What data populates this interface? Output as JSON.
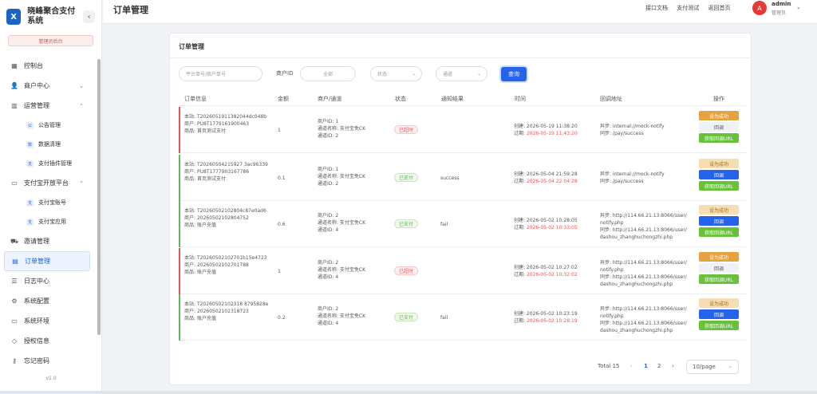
{
  "brand": {
    "logo": "X",
    "name": "晓峰聚合支付系统",
    "collapse": "‹",
    "role_tag": "管理员后台"
  },
  "nav": {
    "dashboard": "控制台",
    "merchant_center": "商户中心",
    "operation": "运营管理",
    "announcements": "公告管理",
    "data_cleanup": "数据清理",
    "plugin_mgmt": "支付插件管理",
    "alipay_platform": "支付宝开放平台",
    "alipay_accounts": "支付宝账号",
    "alipay_apps": "支付宝应用",
    "invite": "邀请管理",
    "orders": "订单管理",
    "logs": "日志中心",
    "config": "系统配置",
    "env": "系统环境",
    "license": "授权信息",
    "forgot_pw": "忘记密码",
    "version": "v1.0"
  },
  "topbar": {
    "title": "订单管理",
    "links": [
      "接口文档",
      "支付测试",
      "返回首页"
    ],
    "avatar": "A",
    "user": "admin",
    "role": "管理员"
  },
  "card": {
    "title": "订单管理"
  },
  "filters": {
    "order_no_placeholder": "平台单号/商户单号",
    "merchant_label": "商户ID",
    "merchant_value": "全部",
    "status_placeholder": "状态",
    "channel_placeholder": "通道",
    "query": "查询"
  },
  "table": {
    "headers": [
      "订单信息",
      "金额",
      "商户/通道",
      "状态",
      "通知结果",
      "时间",
      "回调地址",
      "操作"
    ],
    "rows": [
      {
        "bar": "#e05656",
        "local_label": "本站:",
        "local": "T2026051911382044dc048b",
        "merchant_label": "商户:",
        "merchant": "PU8T1779161900463",
        "goods_label": "商品:",
        "goods": "首页测试支付",
        "amount": "1",
        "mid": "商户ID: 1",
        "cname": "通道名称: 支付宝免CK",
        "cid": "通道ID: 2",
        "status": "已超时",
        "status_type": "over",
        "notify": "",
        "created": "创建: 2026-05-19 11:38:20",
        "expire_label": "过期:",
        "expire": "2026-05-19 11:43:20",
        "async": "异步: internal://mock-notify",
        "sync": "同步: /pay/success",
        "btn_style": "a"
      },
      {
        "bar": "#5cb85c",
        "local_label": "本站:",
        "local": "T20260504215927 3ac96339",
        "merchant_label": "商户:",
        "merchant": "PU8T1777903167786",
        "goods_label": "商品:",
        "goods": "首页测试支付",
        "amount": "0.1",
        "mid": "商户ID: 1",
        "cname": "通道名称: 支付宝免CK",
        "cid": "通道ID: 2",
        "status": "已支付",
        "status_type": "paid",
        "notify": "success",
        "created": "创建: 2026-05-04 21:59:28",
        "expire_label": "过期:",
        "expire": "2026-05-04 22:04:28",
        "async": "异步: internal://mock-notify",
        "sync": "同步: /pay/success",
        "btn_style": "b"
      },
      {
        "bar": "#5cb85c",
        "local_label": "本站:",
        "local": "T20260502102804c87e0ad6",
        "merchant_label": "商户:",
        "merchant": "20260502102804752",
        "goods_label": "商品:",
        "goods": "账户充值",
        "amount": "0.6",
        "mid": "商户ID: 2",
        "cname": "通道名称: 支付宝免CK",
        "cid": "通道ID: 4",
        "status": "已支付",
        "status_type": "paid",
        "notify": "fail",
        "created": "创建: 2026-05-02 10:28:05",
        "expire_label": "过期:",
        "expire": "2026-05-02 10:33:05",
        "async": "异步: http://114.66.21.13:8066/user/notify.php",
        "sync": "同步: http://114.66.21.13:8066/user/dashou_zhanghuchongzhi.php",
        "btn_style": "b"
      },
      {
        "bar": "#e05656",
        "local_label": "本站:",
        "local": "T20260502102701b15e4723",
        "merchant_label": "商户:",
        "merchant": "20260502102701788",
        "goods_label": "商品:",
        "goods": "账户充值",
        "amount": "1",
        "mid": "商户ID: 2",
        "cname": "通道名称: 支付宝免CK",
        "cid": "通道ID: 4",
        "status": "已超时",
        "status_type": "over",
        "notify": "",
        "created": "创建: 2026-05-02 10:27:02",
        "expire_label": "过期:",
        "expire": "2026-05-02 10:32:02",
        "async": "异步: http://114.66.21.13:8066/user/notify.php",
        "sync": "同步: http://114.66.21.13:8066/user/dashou_zhanghuchongzhi.php",
        "btn_style": "a"
      },
      {
        "bar": "#5cb85c",
        "local_label": "本站:",
        "local": "T20260502102318 8795828e",
        "merchant_label": "商户:",
        "merchant": "20260502102318723",
        "goods_label": "商品:",
        "goods": "账户充值",
        "amount": "0.2",
        "mid": "商户ID: 2",
        "cname": "通道名称: 支付宝免CK",
        "cid": "通道ID: 4",
        "status": "已支付",
        "status_type": "paid",
        "notify": "fail",
        "created": "创建: 2026-05-02 10:23:19",
        "expire_label": "过期:",
        "expire": "2026-05-02 10:28:19",
        "async": "异步: http://114.66.21.13:8066/user/notify.php",
        "sync": "同步: http://114.66.21.13:8066/user/dashou_zhanghuchongzhi.php",
        "btn_style": "b"
      }
    ],
    "actions": {
      "set_success": "设为成功",
      "callback": "回调",
      "get_url": "获取回调URL"
    }
  },
  "pagination": {
    "total": "Total 15",
    "prev": "‹",
    "pages": [
      "1",
      "2"
    ],
    "next": "›",
    "size": "10/page",
    "current": "1"
  }
}
